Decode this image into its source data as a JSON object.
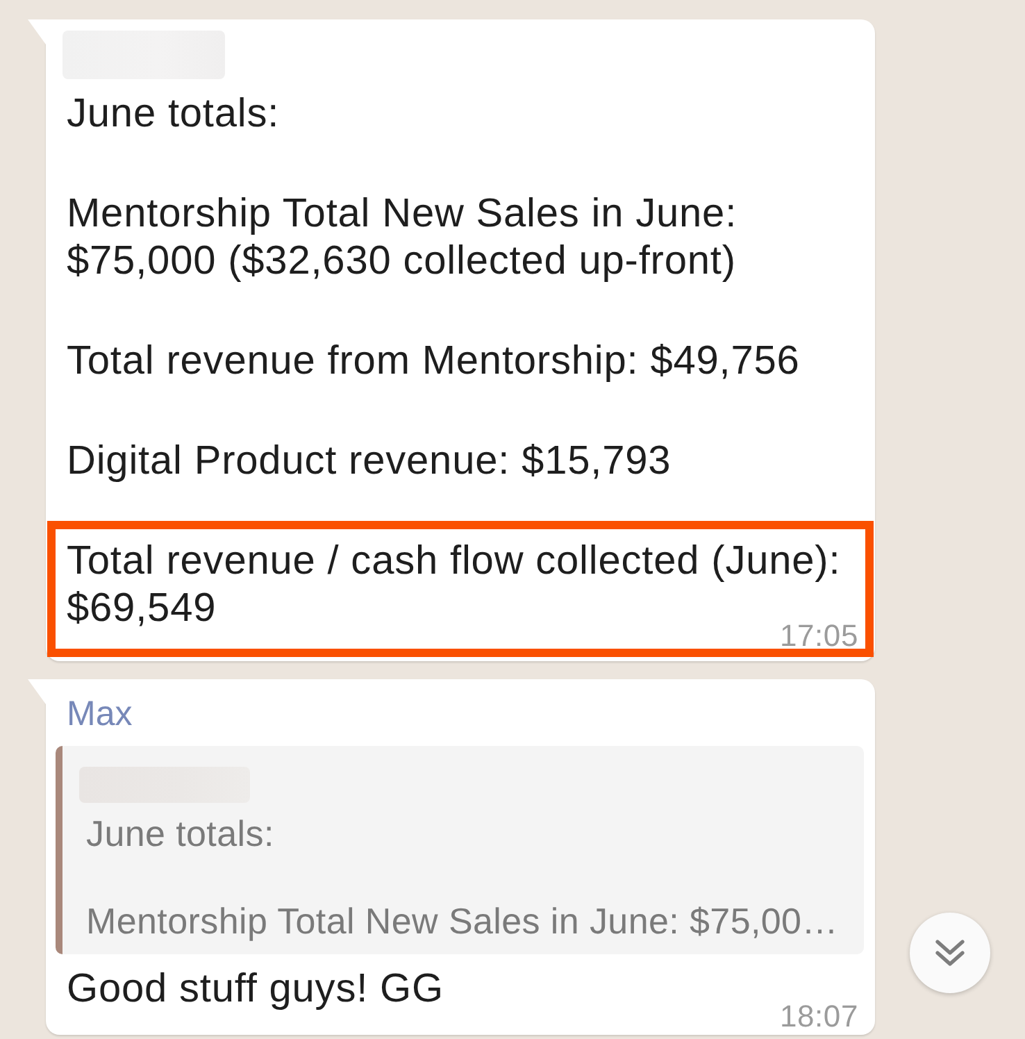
{
  "messages": [
    {
      "sender_redacted": true,
      "paragraphs": [
        {
          "text": "June totals:",
          "highlighted": false
        },
        {
          "text": "Mentorship Total New Sales in June: $75,000 ($32,630 collected up-front)",
          "highlighted": false
        },
        {
          "text": "Total revenue from Mentorship: $49,756",
          "highlighted": false
        },
        {
          "text": "Digital Product revenue: $15,793",
          "highlighted": false
        },
        {
          "text": "Total revenue / cash flow collected (June): $69,549",
          "highlighted": true
        }
      ],
      "time": "17:05"
    },
    {
      "sender": "Max",
      "reply_to": {
        "sender_redacted": true,
        "paragraphs": [
          "June totals:",
          "Mentorship Total New Sales in June: $75,00…"
        ]
      },
      "paragraphs": [
        {
          "text": "Good stuff guys! GG",
          "highlighted": false
        }
      ],
      "time": "18:07"
    }
  ]
}
